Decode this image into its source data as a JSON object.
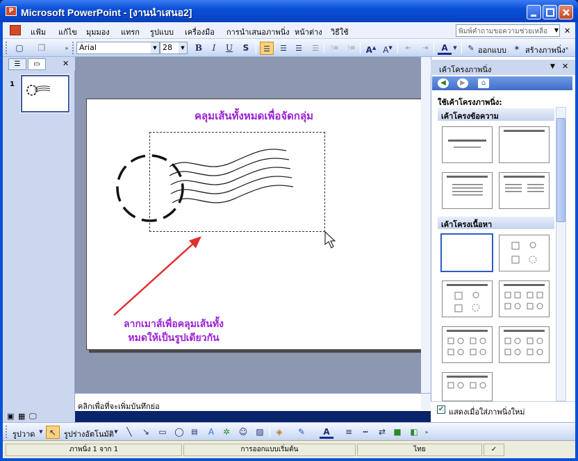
{
  "window": {
    "title": "Microsoft PowerPoint - [งานนำเสนอ2]",
    "app_icon": "powerpoint-icon"
  },
  "menu": {
    "items": [
      "แฟ้ม",
      "แก้ไข",
      "มุมมอง",
      "แทรก",
      "รูปแบบ",
      "เครื่องมือ",
      "การนำเสนอภาพนิ่ง",
      "หน้าต่าง",
      "วิธีใช้"
    ],
    "help_placeholder": "พิมพ์คำถามขอความช่วยเหลือ"
  },
  "toolbar": {
    "font": "Arial",
    "size": "28",
    "bold": "B",
    "italic": "I",
    "underline": "U",
    "shadow": "S",
    "design_label": "ออกแบบ",
    "new_slide_label": "สร้างภาพนิ่ง"
  },
  "slides_panel": {
    "slide_number": "1"
  },
  "slide": {
    "title": "คลุมเส้นทั้งหมดเพื่อจัดกลุ่ม",
    "caption_line1": "ลากเมาส์เพื่อคลุมเส้นทั้ง",
    "caption_line2": "หมดให้เป็นรูปเดียวกัน"
  },
  "notes": {
    "placeholder": "คลิกเพื่อที่จะเพิ่มบันทึกย่อ"
  },
  "drawing_toolbar": {
    "draw_label": "รูปวาด",
    "autoshapes_label": "รูปร่างอัตโนมัติ"
  },
  "statusbar": {
    "slide_info": "ภาพนิ่ง 1 จาก 1",
    "design": "การออกแบบเริ่มต้น",
    "language": "ไทย"
  },
  "taskpane": {
    "title": "เค้าโครงภาพนิ่ง",
    "apply_label": "ใช้เค้าโครงภาพนิ่ง:",
    "section_text": "เค้าโครงข้อความ",
    "section_content": "เค้าโครงเนื้อหา",
    "show_on_insert": "แสดงเมื่อใส่ภาพนิ่งใหม่"
  },
  "colors": {
    "title_purple": "#9c1fd6",
    "arrow_red": "#e03030",
    "xp_blue": "#0a50d8"
  }
}
